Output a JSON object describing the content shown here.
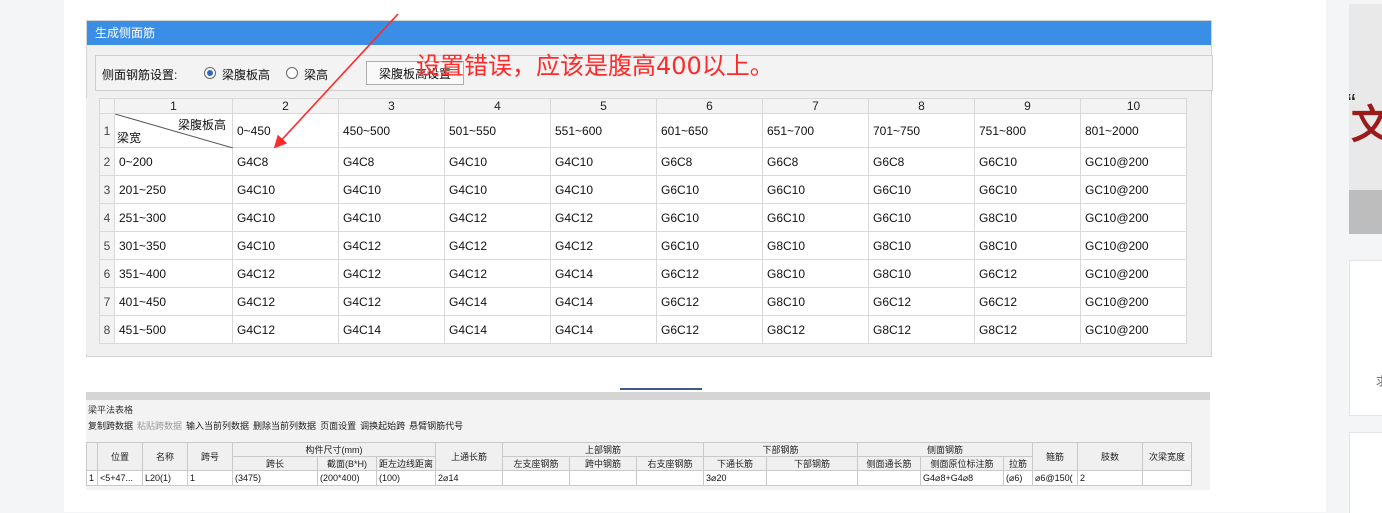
{
  "dialog": {
    "title": "生成侧面筋",
    "setting_label": "侧面钢筋设置:",
    "radio1": "梁腹板高",
    "radio2": "梁高",
    "button": "梁腹板高设置"
  },
  "annotation": "设置错误，应该是腹高400以上。",
  "grid": {
    "col_headers": [
      "1",
      "2",
      "3",
      "4",
      "5",
      "6",
      "7",
      "8",
      "9",
      "10"
    ],
    "corner_top": "梁腹板高",
    "corner_bottom": "梁宽",
    "header_row": [
      "0~450",
      "450~500",
      "501~550",
      "551~600",
      "601~650",
      "651~700",
      "701~750",
      "751~800",
      "801~2000"
    ],
    "rows": [
      {
        "n": "2",
        "cells": [
          "0~200",
          "G4C8",
          "G4C8",
          "G4C10",
          "G4C10",
          "G6C8",
          "G6C8",
          "G6C8",
          "G6C10",
          "GC10@200"
        ]
      },
      {
        "n": "3",
        "cells": [
          "201~250",
          "G4C10",
          "G4C10",
          "G4C10",
          "G4C10",
          "G6C10",
          "G6C10",
          "G6C10",
          "G6C10",
          "GC10@200"
        ]
      },
      {
        "n": "4",
        "cells": [
          "251~300",
          "G4C10",
          "G4C10",
          "G4C12",
          "G4C12",
          "G6C10",
          "G6C10",
          "G6C10",
          "G8C10",
          "GC10@200"
        ]
      },
      {
        "n": "5",
        "cells": [
          "301~350",
          "G4C10",
          "G4C12",
          "G4C12",
          "G4C12",
          "G6C10",
          "G8C10",
          "G8C10",
          "G8C10",
          "GC10@200"
        ]
      },
      {
        "n": "6",
        "cells": [
          "351~400",
          "G4C12",
          "G4C12",
          "G4C12",
          "G4C14",
          "G6C12",
          "G8C10",
          "G8C10",
          "G6C12",
          "GC10@200"
        ]
      },
      {
        "n": "7",
        "cells": [
          "401~450",
          "G4C12",
          "G4C12",
          "G4C14",
          "G4C14",
          "G6C12",
          "G8C10",
          "G6C12",
          "G6C12",
          "GC10@200"
        ]
      },
      {
        "n": "8",
        "cells": [
          "451~500",
          "G4C12",
          "G4C14",
          "G4C14",
          "G4C14",
          "G6C12",
          "G8C12",
          "G8C12",
          "G8C12",
          "GC10@200"
        ]
      }
    ]
  },
  "bottom": {
    "title": "梁平法表格",
    "menu": [
      {
        "label": "复制跨数据",
        "enabled": true
      },
      {
        "label": "粘贴跨数据",
        "enabled": false
      },
      {
        "label": "输入当前列数据",
        "enabled": true
      },
      {
        "label": "删除当前列数据",
        "enabled": true
      },
      {
        "label": "页面设置",
        "enabled": true
      },
      {
        "label": "调换起始跨",
        "enabled": true
      },
      {
        "label": "悬臂钢筋代号",
        "enabled": true
      }
    ],
    "h1": {
      "pos": "位置",
      "name": "名称",
      "span": "跨号",
      "dims": "构件尺寸(mm)",
      "top_len": "上通长筋",
      "top_bar": "上部钢筋",
      "bot_bar": "下部钢筋",
      "side_bar": "侧面钢筋",
      "stirrup": "箍筋",
      "legs": "肢数",
      "sec_beam": "次梁宽度"
    },
    "h2": {
      "span_len": "跨长",
      "section": "截面(B*H)",
      "edge": "距左边线距离",
      "left_sup": "左支座钢筋",
      "mid": "跨中钢筋",
      "right_sup": "右支座钢筋",
      "bot_len": "下通长筋",
      "bot": "下部钢筋",
      "side_len": "侧面通长筋",
      "side_mark": "侧面原位标注筋",
      "tie": "拉筋"
    },
    "row": {
      "idx": "1",
      "pos": "<5+47...",
      "name": "L20(1)",
      "span": "1",
      "span_len": "(3475)",
      "section": "(200*400)",
      "edge": "(100)",
      "top_len": "2⌀14",
      "bot_len": "3⌀20",
      "side_mark": "G4⌀8+G4⌀8",
      "tie": "(⌀6)",
      "stirrup": "⌀6@150(",
      "legs": "2"
    }
  },
  "colors": {
    "accent": "#3a8ee6",
    "annotation": "#ff2a2a",
    "highlight": "#22c422"
  }
}
